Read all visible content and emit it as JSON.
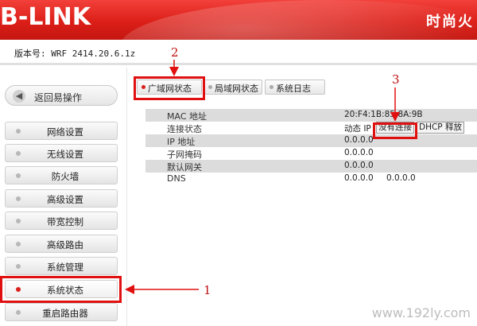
{
  "header": {
    "logo_text": "B-LINK",
    "brand_text": "时尚火",
    "accent_color": "#dc1f18"
  },
  "version": {
    "label": "版本号: WRF 2414.20.6.1z"
  },
  "sidebar": {
    "back_label": "返回易操作",
    "back_icon": "left-arrow-icon",
    "items": [
      {
        "label": "网络设置",
        "active": false
      },
      {
        "label": "无线设置",
        "active": false
      },
      {
        "label": "防火墙",
        "active": false
      },
      {
        "label": "高级设置",
        "active": false
      },
      {
        "label": "带宽控制",
        "active": false
      },
      {
        "label": "高级路由",
        "active": false
      },
      {
        "label": "系统管理",
        "active": false
      },
      {
        "label": "系统状态",
        "active": true
      },
      {
        "label": "重启路由器",
        "active": false
      }
    ]
  },
  "tabs": [
    {
      "label": "广域网状态",
      "active": true
    },
    {
      "label": "局域网状态",
      "active": false
    },
    {
      "label": "系统日志",
      "active": false
    }
  ],
  "status_table": {
    "rows": [
      {
        "key": "MAC 地址",
        "value": "20:F4:1B:85:8A:9B"
      },
      {
        "key": "连接状态",
        "value": "动态 IP",
        "button1": "没有连接",
        "button2": "DHCP 释放"
      },
      {
        "key": "IP 地址",
        "value": "0.0.0.0"
      },
      {
        "key": "子网掩码",
        "value": "0.0.0.0"
      },
      {
        "key": "默认网关",
        "value": "0.0.0.0"
      },
      {
        "key": "DNS",
        "value": "0.0.0.0",
        "value2": "0.0.0.0"
      }
    ]
  },
  "annotations": {
    "marker1": "1",
    "marker2": "2",
    "marker3": "3",
    "color": "#e01010"
  },
  "watermark": "www.192ly.com"
}
